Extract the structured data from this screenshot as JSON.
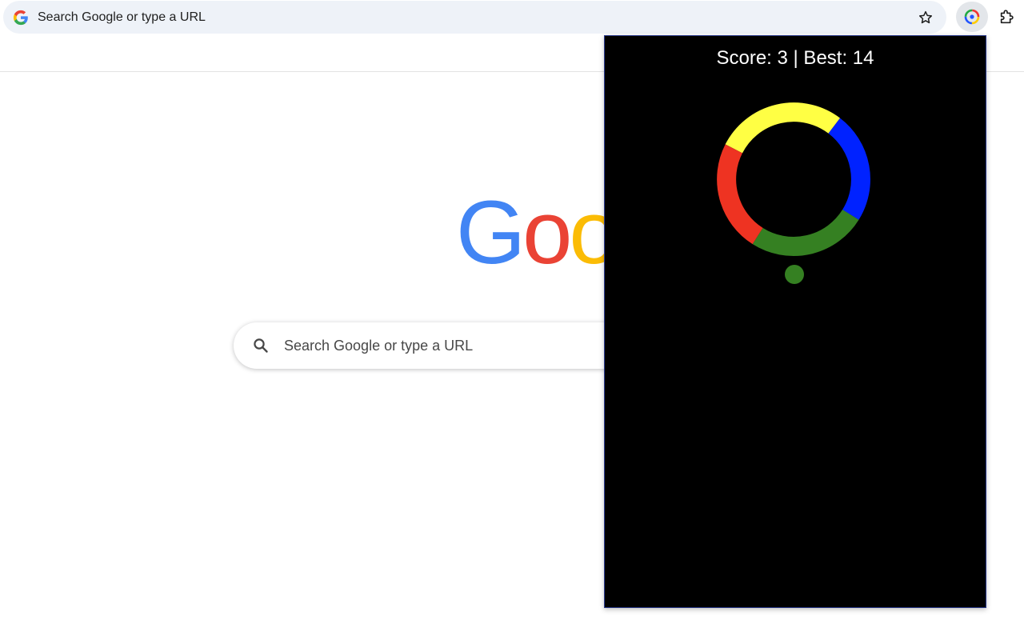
{
  "browser": {
    "omnibox_text": "Search Google or type a URL",
    "icons": {
      "site": "google-g-icon",
      "bookmark": "star-icon",
      "active_extension": "color-ring-extension-icon",
      "extensions_menu": "puzzle-icon"
    }
  },
  "ntp": {
    "logo_letters": [
      "G",
      "o",
      "o"
    ],
    "logo_colors": [
      "#4285f4",
      "#ea4335",
      "#fbbc05"
    ],
    "search_placeholder": "Search Google or type a URL"
  },
  "game": {
    "score_text": "Score: 3 | Best: 14",
    "score": 3,
    "best": 14,
    "ring_segments": [
      {
        "color": "#ffff44"
      },
      {
        "color": "#0022ff"
      },
      {
        "color": "#358022"
      },
      {
        "color": "#ee3322"
      }
    ],
    "ball_color": "#358022",
    "background": "#000000"
  }
}
